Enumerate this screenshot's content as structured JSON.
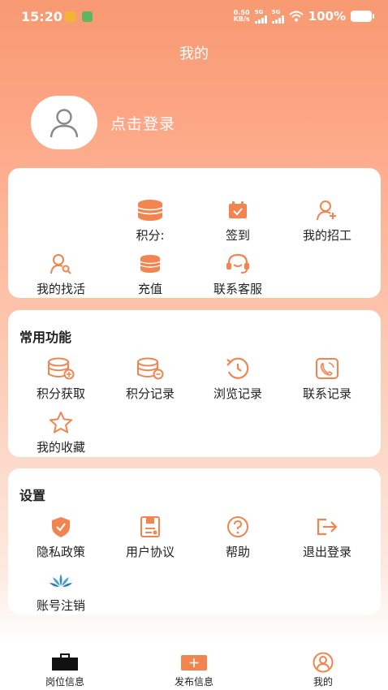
{
  "status_bar": {
    "time": "15:20",
    "net_speed_value": "0.50",
    "net_speed_unit": "KB/s",
    "signal_1": "5G",
    "signal_2": "5G",
    "battery": "100%"
  },
  "header": {
    "title": "我的"
  },
  "profile": {
    "login_label": "点击登录"
  },
  "quick_panel": {
    "items": [
      {
        "label": "积分:",
        "icon": "coins-stack-icon"
      },
      {
        "label": "签到",
        "icon": "calendar-check-icon"
      },
      {
        "label": "我的招工",
        "icon": "user-add-icon"
      },
      {
        "label": "我的找活",
        "icon": "user-search-icon"
      },
      {
        "label": "充值",
        "icon": "coin-stack-icon"
      },
      {
        "label": "联系客服",
        "icon": "headset-icon"
      }
    ]
  },
  "common_functions": {
    "title": "常用功能",
    "items": [
      {
        "label": "积分获取",
        "icon": "database-add-icon"
      },
      {
        "label": "积分记录",
        "icon": "database-record-icon"
      },
      {
        "label": "浏览记录",
        "icon": "history-icon"
      },
      {
        "label": "联系记录",
        "icon": "phone-log-icon"
      },
      {
        "label": "我的收藏",
        "icon": "star-icon"
      }
    ]
  },
  "settings": {
    "title": "设置",
    "items": [
      {
        "label": "隐私政策",
        "icon": "shield-check-icon"
      },
      {
        "label": "用户协议",
        "icon": "document-icon"
      },
      {
        "label": "帮助",
        "icon": "help-icon"
      },
      {
        "label": "退出登录",
        "icon": "logout-icon"
      },
      {
        "label": "账号注销",
        "icon": "lotus-icon"
      }
    ]
  },
  "tabbar": {
    "tabs": [
      {
        "label": "岗位信息",
        "icon": "briefcase-icon"
      },
      {
        "label": "发布信息",
        "icon": "plus-square-icon"
      },
      {
        "label": "我的",
        "icon": "user-circle-icon"
      }
    ]
  },
  "colors": {
    "accent": "#f2854f",
    "header_bg": "#f79a72",
    "card_bg": "#ffffff",
    "text": "#222222"
  }
}
